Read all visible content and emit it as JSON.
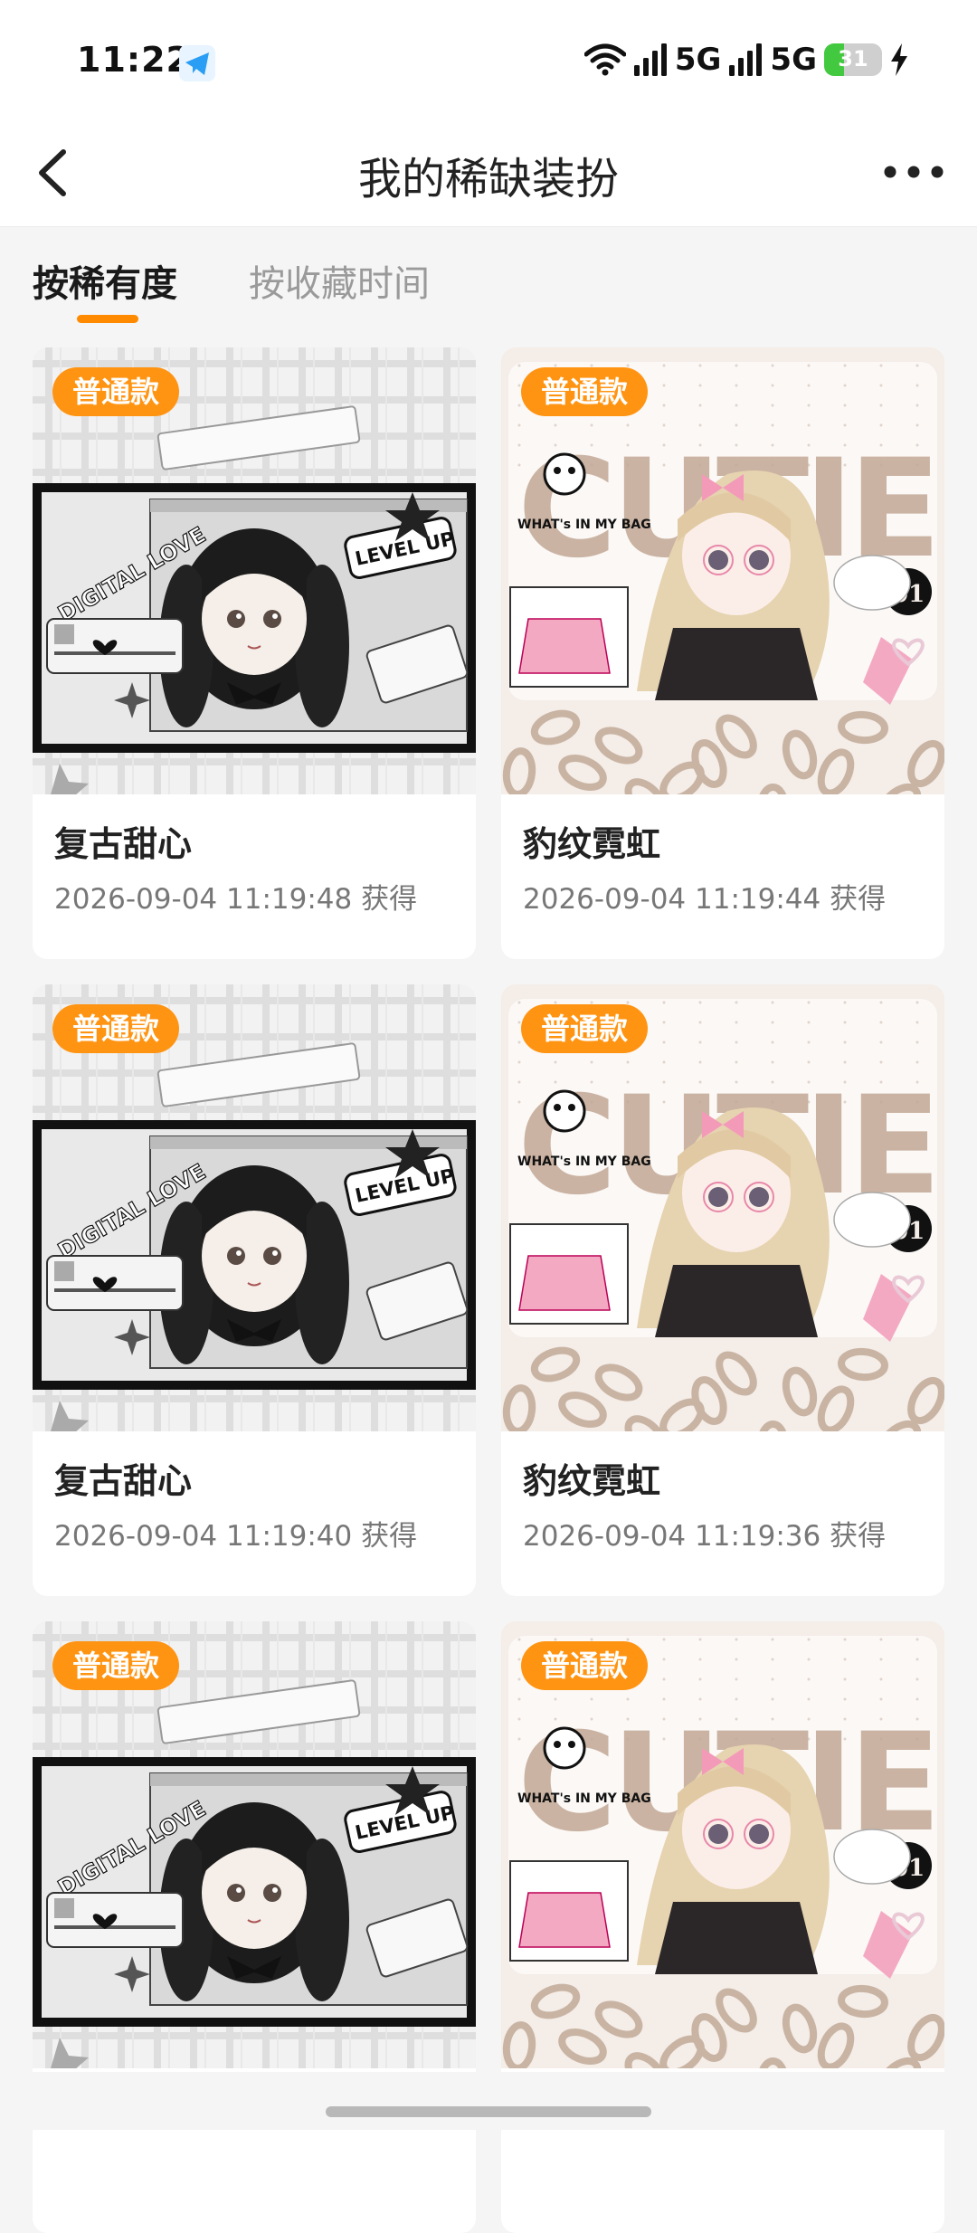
{
  "status_bar": {
    "time": "11:22",
    "network_1": "5G",
    "network_2": "5G",
    "battery": "31"
  },
  "header": {
    "title": "我的稀缺装扮"
  },
  "tabs": [
    {
      "label": "按稀有度",
      "active": true
    },
    {
      "label": "按收藏时间",
      "active": false
    }
  ],
  "accent_color": "#ff8a00",
  "items": [
    {
      "badge": "普通款",
      "name": "复古甜心",
      "time": "2026-09-04 11:19:48 获得",
      "style": "mono"
    },
    {
      "badge": "普通款",
      "name": "豹纹霓虹",
      "time": "2026-09-04 11:19:44 获得",
      "style": "leopard"
    },
    {
      "badge": "普通款",
      "name": "复古甜心",
      "time": "2026-09-04 11:19:40 获得",
      "style": "mono"
    },
    {
      "badge": "普通款",
      "name": "豹纹霓虹",
      "time": "2026-09-04 11:19:36 获得",
      "style": "leopard"
    },
    {
      "badge": "普通款",
      "name": "",
      "time": "",
      "style": "mono"
    },
    {
      "badge": "普通款",
      "name": "",
      "time": "",
      "style": "leopard"
    }
  ],
  "art_text": {
    "mono_tag": "DIGITAL LOVE",
    "mono_sticker": "LEVEL UP",
    "leopard_word": "CUTIE",
    "leopard_bag": "WHAT's IN MY BAG",
    "leopard_no": "01"
  }
}
